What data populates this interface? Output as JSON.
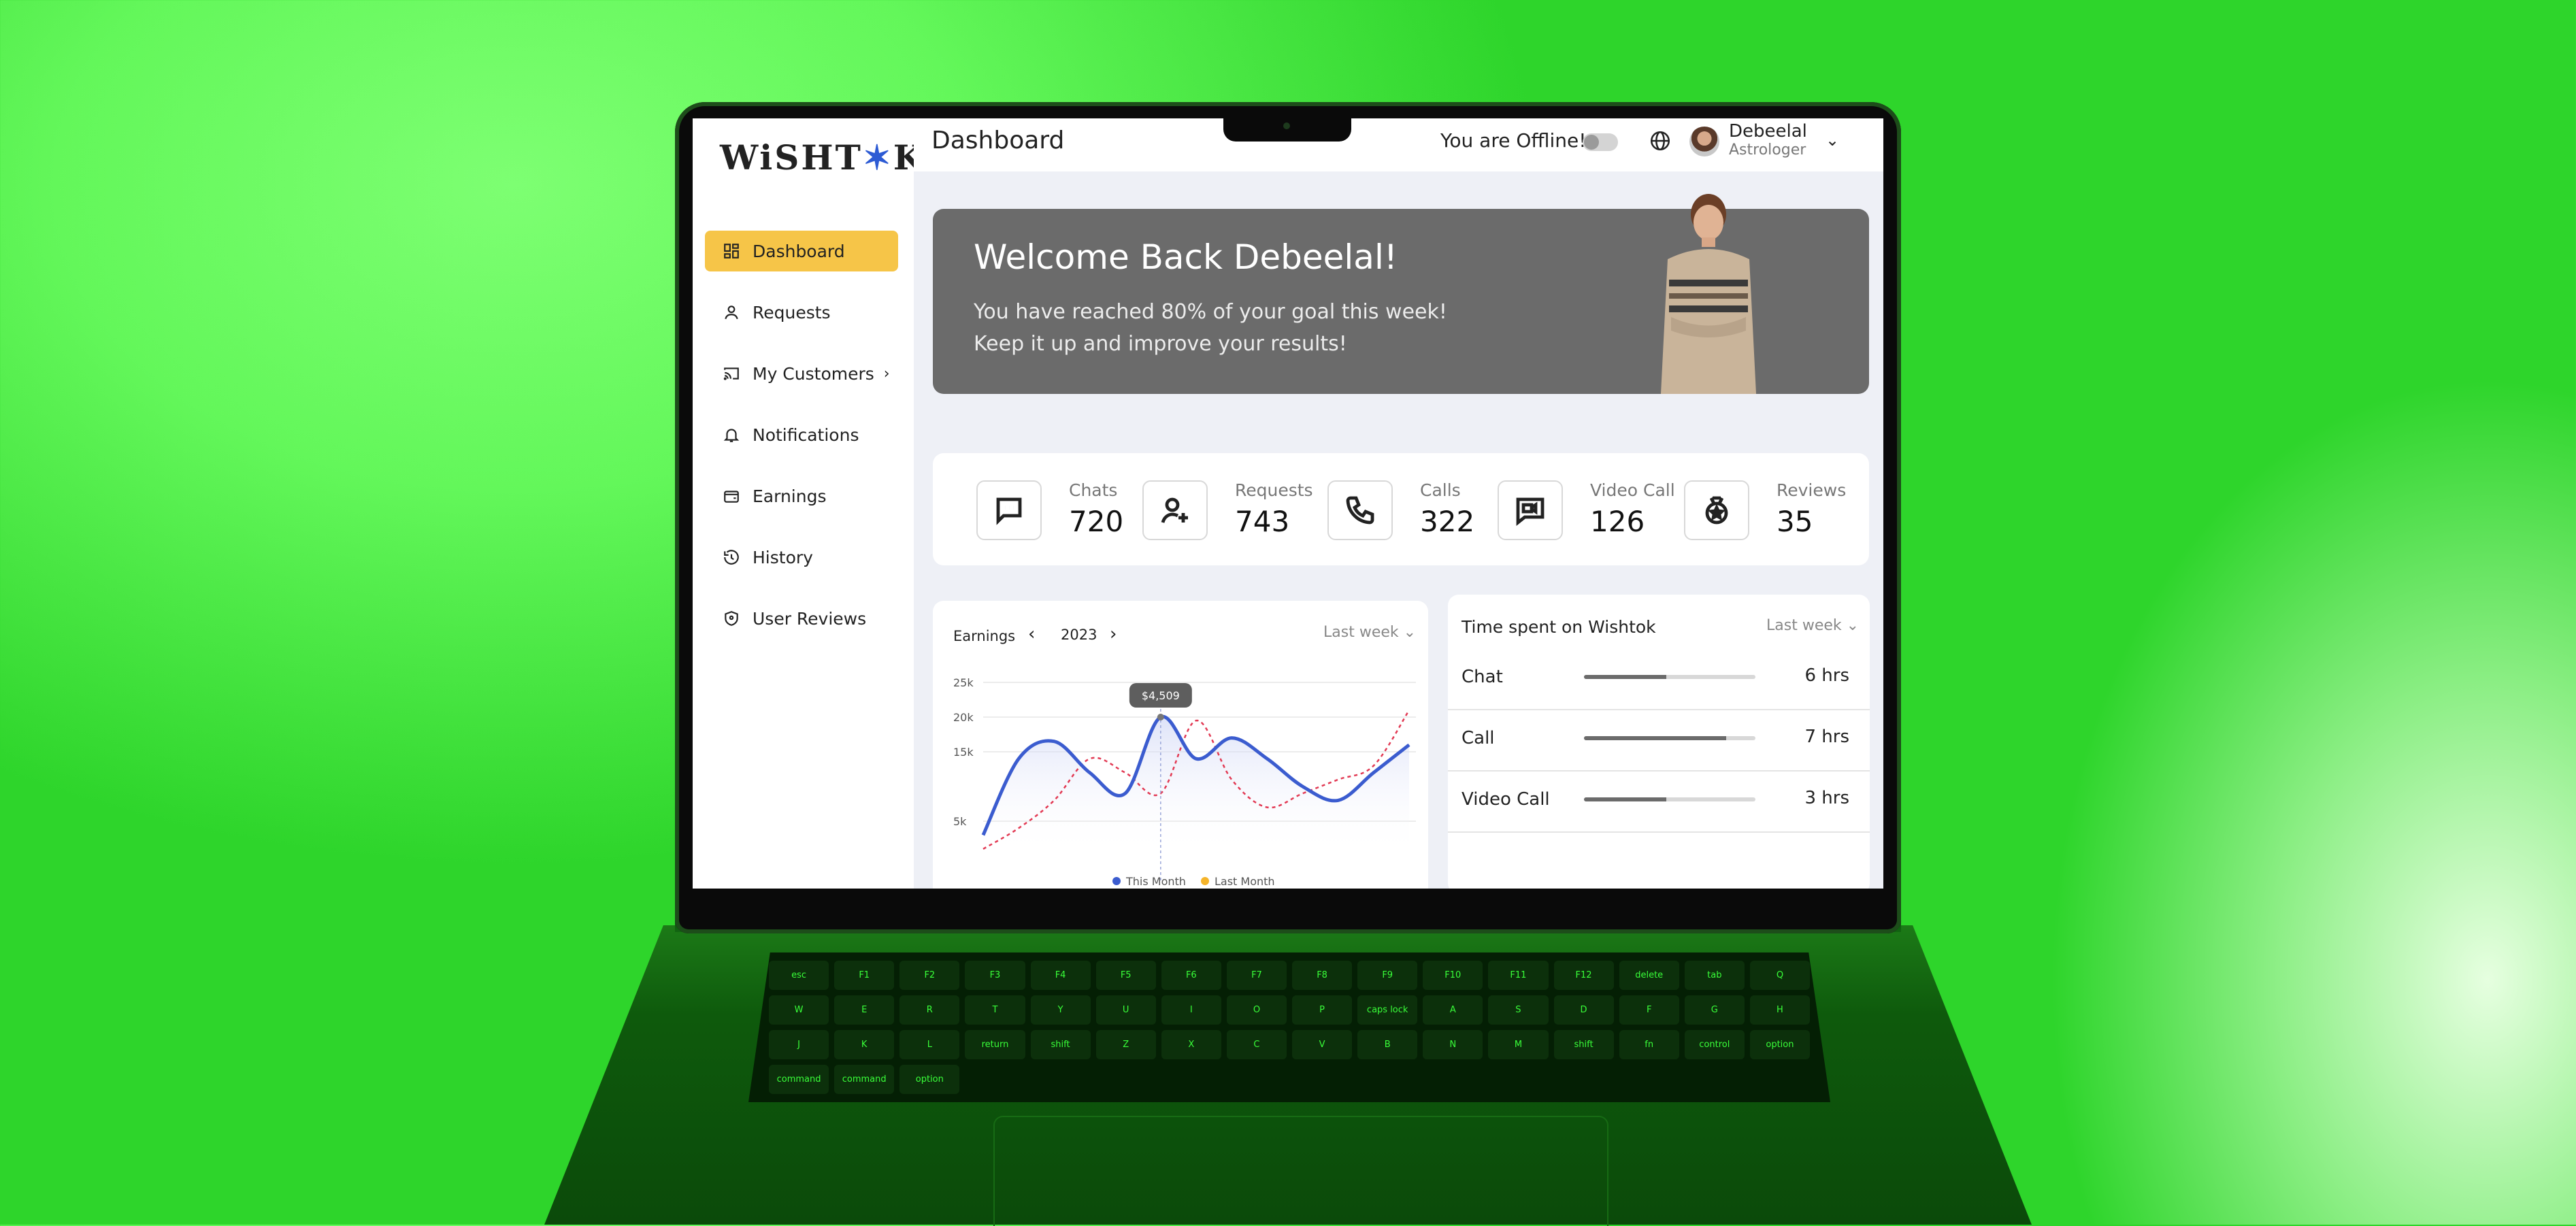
{
  "app": {
    "logo": "WiSHT✶K",
    "page_title": "Dashboard"
  },
  "header": {
    "offline_text": "You are Offline!",
    "online_toggle": false,
    "user_name": "Debeelal",
    "user_role": "Astrologer"
  },
  "sidebar": {
    "items": [
      {
        "label": "Dashboard",
        "icon": "dashboard-icon",
        "active": true
      },
      {
        "label": "Requests",
        "icon": "user-icon"
      },
      {
        "label": "My Customers",
        "icon": "cast-icon",
        "has_submenu": true
      },
      {
        "label": "Notifications",
        "icon": "bell-icon"
      },
      {
        "label": "Earnings",
        "icon": "wallet-icon"
      },
      {
        "label": "History",
        "icon": "history-icon"
      },
      {
        "label": "User Reviews",
        "icon": "shield-icon"
      }
    ]
  },
  "banner": {
    "title": "Welcome Back Debeelal!",
    "line1": "You have reached 80% of your goal this week!",
    "line2": "Keep it up and improve your results!"
  },
  "stats": [
    {
      "label": "Chats",
      "value": "720",
      "icon": "chat-icon"
    },
    {
      "label": "Requests",
      "value": "743",
      "icon": "add-user-icon"
    },
    {
      "label": "Calls",
      "value": "322",
      "icon": "phone-icon"
    },
    {
      "label": "Video Call",
      "value": "126",
      "icon": "video-chat-icon"
    },
    {
      "label": "Reviews",
      "value": "35",
      "icon": "medal-icon"
    }
  ],
  "earnings": {
    "title": "Earnings",
    "year": "2023",
    "period": "Last week ⌄",
    "tooltip": "$4,509"
  },
  "chart_data": {
    "type": "line",
    "title": "Earnings",
    "y_ticks": [
      "25k",
      "20k",
      "15k",
      "5k"
    ],
    "ylim": [
      0,
      25000
    ],
    "x": [
      0,
      1,
      2,
      3,
      4,
      5,
      6,
      7,
      8,
      9,
      10,
      11,
      12
    ],
    "series": [
      {
        "name": "This Month",
        "color": "#3b5ccf",
        "values": [
          3000,
          14000,
          16500,
          12000,
          9000,
          20000,
          14000,
          17000,
          14000,
          10000,
          8000,
          12000,
          16000
        ]
      },
      {
        "name": "Last Month",
        "color": "#e23a54",
        "dashed": true,
        "values": [
          1000,
          4000,
          8000,
          14000,
          12000,
          9000,
          19500,
          11000,
          7000,
          9000,
          11000,
          13000,
          21000
        ]
      }
    ],
    "legend": [
      "This Month",
      "Last Month"
    ],
    "legend_colors": [
      "#3b5ccf",
      "#f5b42a"
    ],
    "highlight_index": 5
  },
  "time_spent": {
    "title": "Time spent on Wishtok",
    "period": "Last week ⌄",
    "rows": [
      {
        "label": "Chat",
        "value": "6 hrs",
        "fraction": 0.48
      },
      {
        "label": "Call",
        "value": "7 hrs",
        "fraction": 0.83
      },
      {
        "label": "Video Call",
        "value": "3 hrs",
        "fraction": 0.48
      }
    ]
  },
  "keyboard": {
    "keys": [
      "esc",
      "F1",
      "F2",
      "F3",
      "F4",
      "F5",
      "F6",
      "F7",
      "F8",
      "F9",
      "F10",
      "F11",
      "F12",
      "delete",
      "tab",
      "Q",
      "W",
      "E",
      "R",
      "T",
      "Y",
      "U",
      "I",
      "O",
      "P",
      "caps lock",
      "A",
      "S",
      "D",
      "F",
      "G",
      "H",
      "J",
      "K",
      "L",
      "return",
      "shift",
      "Z",
      "X",
      "C",
      "V",
      "B",
      "N",
      "M",
      "shift",
      "fn",
      "control",
      "option",
      "command",
      "command",
      "option"
    ]
  }
}
